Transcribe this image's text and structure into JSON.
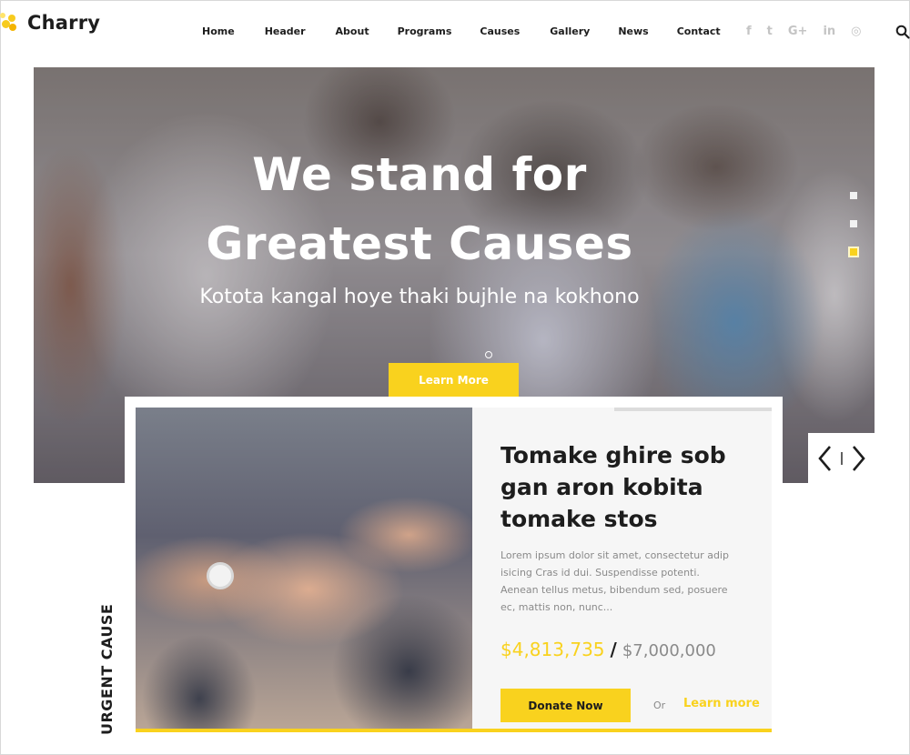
{
  "brand": {
    "name": "Charry",
    "accent": "#f9d21e"
  },
  "nav": {
    "items": [
      {
        "label": "Home"
      },
      {
        "label": "Header"
      },
      {
        "label": "About"
      },
      {
        "label": "Programs"
      },
      {
        "label": "Causes"
      },
      {
        "label": "Gallery"
      },
      {
        "label": "News"
      },
      {
        "label": "Contact"
      }
    ]
  },
  "social": {
    "icons": [
      {
        "name": "facebook-icon",
        "glyph": "f"
      },
      {
        "name": "twitter-icon",
        "glyph": "t"
      },
      {
        "name": "google-plus-icon",
        "glyph": "G+"
      },
      {
        "name": "linkedin-icon",
        "glyph": "in"
      },
      {
        "name": "dribbble-icon",
        "glyph": "◎"
      }
    ],
    "search_icon": "search-icon"
  },
  "hero": {
    "title_line1": "We stand for",
    "title_line2": "Greatest Causes",
    "subtitle": "Kotota kangal hoye thaki bujhle na kokhono",
    "button_label": "Learn More",
    "slides_total": 3,
    "active_slide": 3
  },
  "cause": {
    "section_label": "URGENT CAUSE",
    "title": "Tomake ghire sob gan aron kobita tomake stos",
    "description": "Lorem ipsum dolor sit amet, consectetur adip isicing Cras id dui. Suspendisse potenti. Aenean tellus metus, bibendum sed, posuere ec, mattis non, nunc...",
    "raised": "$4,813,735",
    "separator": "/",
    "goal": "$7,000,000",
    "donate_label": "Donate Now",
    "or_label": "Or",
    "learn_label": "Learn more"
  },
  "slider_arrows": {
    "prev_icon": "chevron-left-icon",
    "next_icon": "chevron-right-icon"
  }
}
